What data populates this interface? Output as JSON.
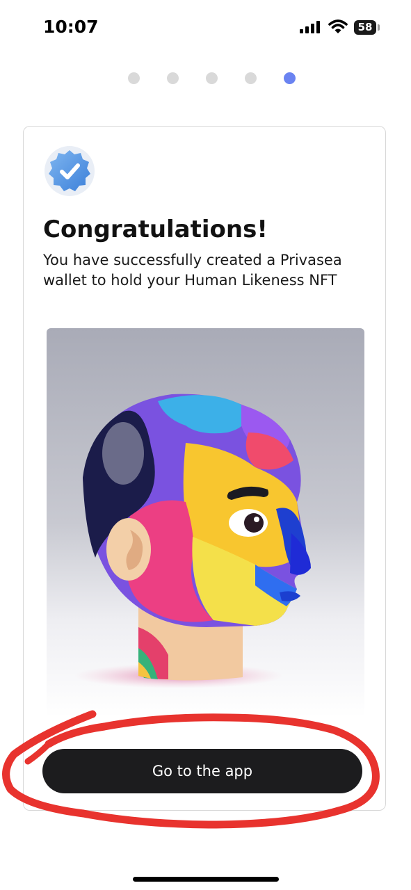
{
  "status_bar": {
    "time": "10:07",
    "battery": "58",
    "signal_icon": "cellular-signal-icon",
    "wifi_icon": "wifi-icon"
  },
  "pager": {
    "total": 5,
    "active_index": 4,
    "active_color": "#6a83f1",
    "inactive_color": "#d9d9d9"
  },
  "card": {
    "badge_icon": "verified-badge-icon",
    "title": "Congratulations!",
    "subtitle": "You have successfully created a Privasea wallet to hold your Human Likeness NFT",
    "image_icon": "human-likeness-nft-head-image",
    "cta_label": "Go to the app"
  },
  "annotation": {
    "color": "#e8332e",
    "icon": "red-freehand-circle"
  },
  "colors": {
    "button_bg": "#1c1c1e",
    "badge_blue": "#4a90e2"
  }
}
